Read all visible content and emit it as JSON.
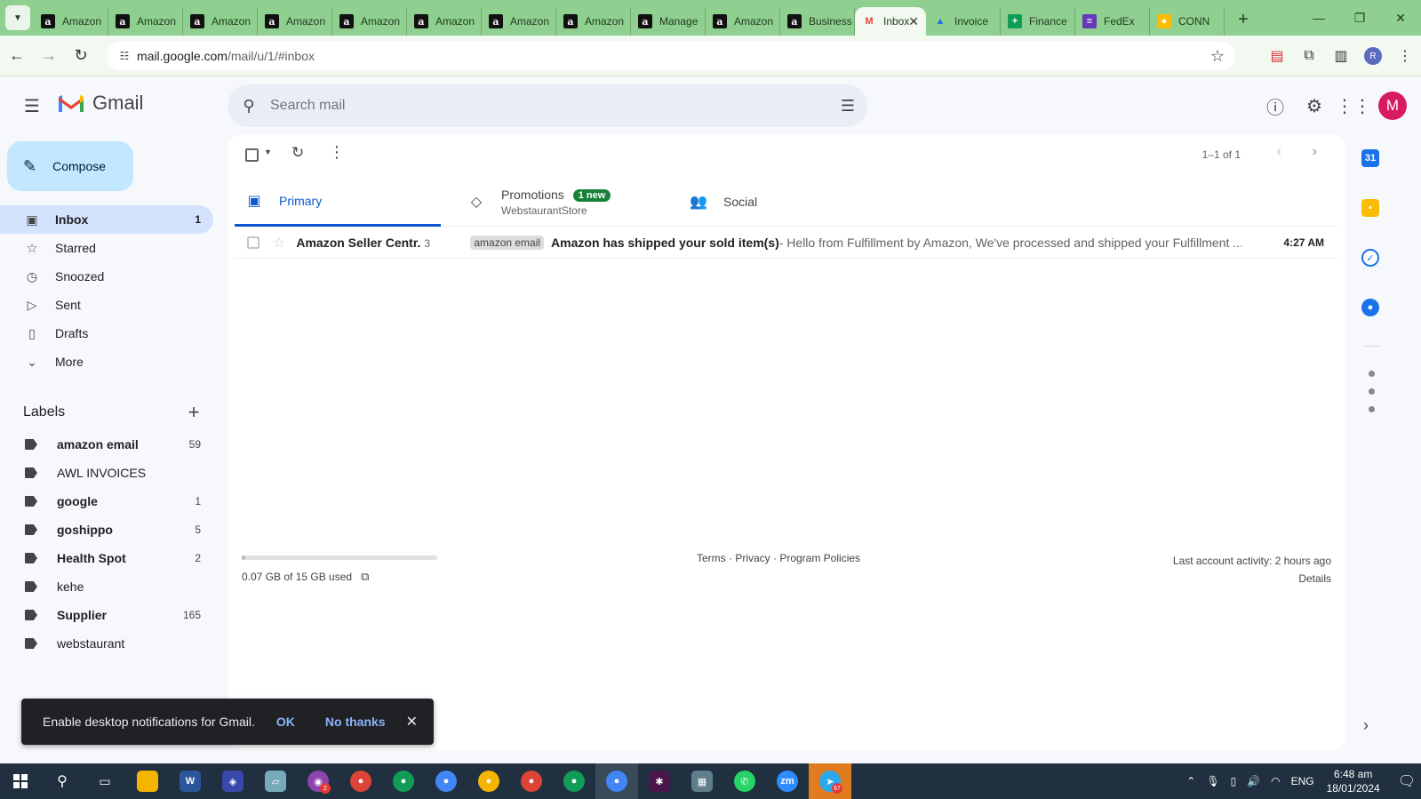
{
  "browser": {
    "tabs": [
      {
        "label": "Amazon",
        "fav": "a"
      },
      {
        "label": "Amazon",
        "fav": "a"
      },
      {
        "label": "Amazon",
        "fav": "a"
      },
      {
        "label": "Amazon",
        "fav": "a"
      },
      {
        "label": "Amazon",
        "fav": "a"
      },
      {
        "label": "Amazon",
        "fav": "a"
      },
      {
        "label": "Amazon",
        "fav": "a"
      },
      {
        "label": "Amazon",
        "fav": "a"
      },
      {
        "label": "Manage",
        "fav": "a"
      },
      {
        "label": "Amazon",
        "fav": "a"
      },
      {
        "label": "Business",
        "fav": "a"
      },
      {
        "label": "Inbox",
        "fav": "M",
        "active": true
      },
      {
        "label": "Invoice",
        "fav": "drive"
      },
      {
        "label": "Finance",
        "fav": "sheet"
      },
      {
        "label": "FedEx",
        "fav": "form"
      },
      {
        "label": "CONN",
        "fav": "chrome"
      }
    ],
    "url_host": "mail.google.com",
    "url_path": "/mail/u/1/#inbox",
    "profile_initial": "R"
  },
  "gmail": {
    "app_name": "Gmail",
    "search_placeholder": "Search mail",
    "avatar_initial": "M",
    "compose_label": "Compose",
    "nav": [
      {
        "label": "Inbox",
        "count": "1",
        "icon": "inbox-icon",
        "glyph": "▣",
        "active": true
      },
      {
        "label": "Starred",
        "count": "",
        "icon": "star-icon",
        "glyph": "☆"
      },
      {
        "label": "Snoozed",
        "count": "",
        "icon": "clock-icon",
        "glyph": "◷"
      },
      {
        "label": "Sent",
        "count": "",
        "icon": "send-icon",
        "glyph": "▷"
      },
      {
        "label": "Drafts",
        "count": "",
        "icon": "draft-icon",
        "glyph": "▯"
      },
      {
        "label": "More",
        "count": "",
        "icon": "chevron-down-icon",
        "glyph": "⌄"
      }
    ],
    "labels_title": "Labels",
    "labels": [
      {
        "label": "amazon email",
        "count": "59",
        "bold": true
      },
      {
        "label": "AWL INVOICES",
        "count": "",
        "bold": false
      },
      {
        "label": "google",
        "count": "1",
        "bold": true
      },
      {
        "label": "goshippo",
        "count": "5",
        "bold": true
      },
      {
        "label": "Health Spot",
        "count": "2",
        "bold": true
      },
      {
        "label": "kehe",
        "count": "",
        "bold": false
      },
      {
        "label": "Supplier",
        "count": "165",
        "bold": true
      },
      {
        "label": "webstaurant",
        "count": "",
        "bold": false
      }
    ],
    "pagination": "1–1 of 1",
    "tabs": {
      "primary": "Primary",
      "promotions": "Promotions",
      "promotions_badge": "1 new",
      "promotions_sub": "WebstaurantStore",
      "social": "Social"
    },
    "messages": [
      {
        "sender": "Amazon Seller Centr.",
        "thread_count": "3",
        "label": "amazon email",
        "subject": "Amazon has shipped your sold item(s)",
        "snippet": " - Hello from Fulfillment by Amazon, We've processed and shipped your Fulfillment ...",
        "time": "4:27 AM"
      }
    ],
    "footer": {
      "storage": "0.07 GB of 15 GB used",
      "storage_fraction": 0.005,
      "links": "Terms · Privacy · Program Policies",
      "activity": "Last account activity: 2 hours ago",
      "details": "Details"
    },
    "snackbar": {
      "message": "Enable desktop notifications for Gmail.",
      "ok": "OK",
      "no_thanks": "No thanks"
    },
    "sidepanel": {
      "calendar_day": "31"
    }
  },
  "taskbar": {
    "language": "ENG",
    "time": "6:48 am",
    "date": "18/01/2024",
    "telegram_badge": "67",
    "badge_2": "2"
  },
  "colors": {
    "tabbar": "#8fcf8f",
    "accent": "#0b57d0",
    "compose": "#c2e7ff",
    "inbox_active": "#d3e3fd",
    "avatar": "#d81b60"
  }
}
